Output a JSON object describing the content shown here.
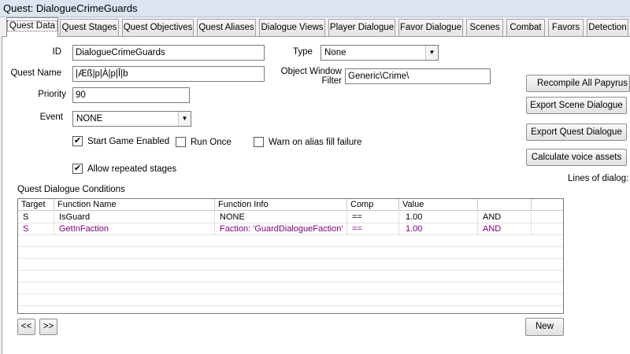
{
  "window": {
    "title": "Quest: DialogueCrimeGuards"
  },
  "tabs": [
    {
      "label": "Quest Data"
    },
    {
      "label": "Quest Stages"
    },
    {
      "label": "Quest Objectives"
    },
    {
      "label": "Quest Aliases"
    },
    {
      "label": "Dialogue Views"
    },
    {
      "label": "Player Dialogue"
    },
    {
      "label": "Favor Dialogue"
    },
    {
      "label": "Scenes"
    },
    {
      "label": "Combat"
    },
    {
      "label": "Favors"
    },
    {
      "label": "Detection"
    }
  ],
  "form": {
    "id_label": "ID",
    "id_value": "DialogueCrimeGuards",
    "name_label": "Quest Name",
    "name_value": "|Æß|p|À|p|Î|b",
    "priority_label": "Priority",
    "priority_value": "90",
    "event_label": "Event",
    "event_value": "NONE",
    "type_label": "Type",
    "type_value": "None",
    "filter_label_line1": "Object Window",
    "filter_label_line2": "Filter",
    "filter_value": "Generic\\Crime\\",
    "start_enabled_label": "Start Game Enabled",
    "run_once_label": "Run Once",
    "warn_alias_label": "Warn on alias fill failure",
    "allow_repeated_label": "Allow repeated stages"
  },
  "checkboxes": {
    "start_enabled": true,
    "run_once": false,
    "warn_alias": false,
    "allow_repeated": true
  },
  "check_mark": "✔",
  "buttons": {
    "recompile": "Recompile All Papyrus Scripts",
    "export_scene": "Export Scene Dialogue",
    "export_quest": "Export Quest Dialogue",
    "calc_voice": "Calculate voice assets",
    "prev": "<<",
    "next": ">>",
    "new": "New"
  },
  "lines_of_dialog_label": "Lines of dialog:",
  "conditions": {
    "title": "Quest Dialogue Conditions",
    "columns": [
      "Target",
      "Function Name",
      "Function Info",
      "Comp",
      "Value",
      "",
      ""
    ],
    "rows": [
      [
        "S",
        "IsGuard",
        "NONE",
        "==",
        "1.00",
        "AND",
        ""
      ],
      [
        "S",
        "GetInFaction",
        "Faction: 'GuardDialogueFaction'",
        "==",
        "1.00",
        "AND",
        ""
      ]
    ]
  },
  "colors": {
    "selected_row_text": "#800080",
    "titlebar": "#dbe4ef"
  }
}
